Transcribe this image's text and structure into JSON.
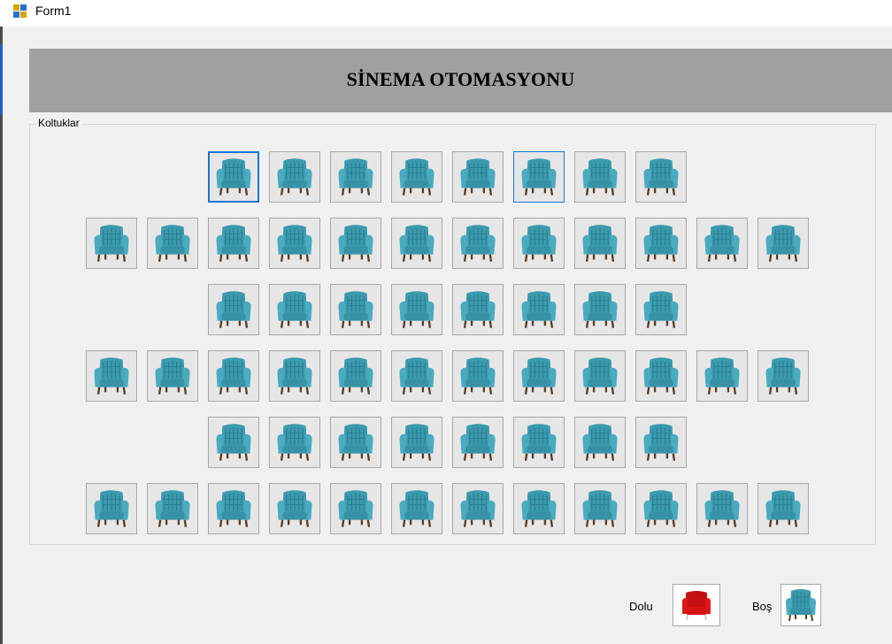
{
  "window": {
    "title": "Form1"
  },
  "banner": {
    "title": "SİNEMA OTOMASYONU"
  },
  "seating": {
    "caption": "Koltuklar",
    "row_counts": [
      8,
      12,
      8,
      12,
      8,
      12
    ],
    "focused_seat": [
      0,
      0
    ],
    "selected_seat": [
      0,
      5
    ]
  },
  "legend": {
    "occupied_label": "Dolu",
    "empty_label": "Boş",
    "occupied_color": "#d01010",
    "empty_color": "#3a9aae"
  },
  "colors": {
    "banner_bg": "#a0a0a0",
    "form_bg": "#f0f0f0",
    "focus_border": "#1976d2"
  }
}
